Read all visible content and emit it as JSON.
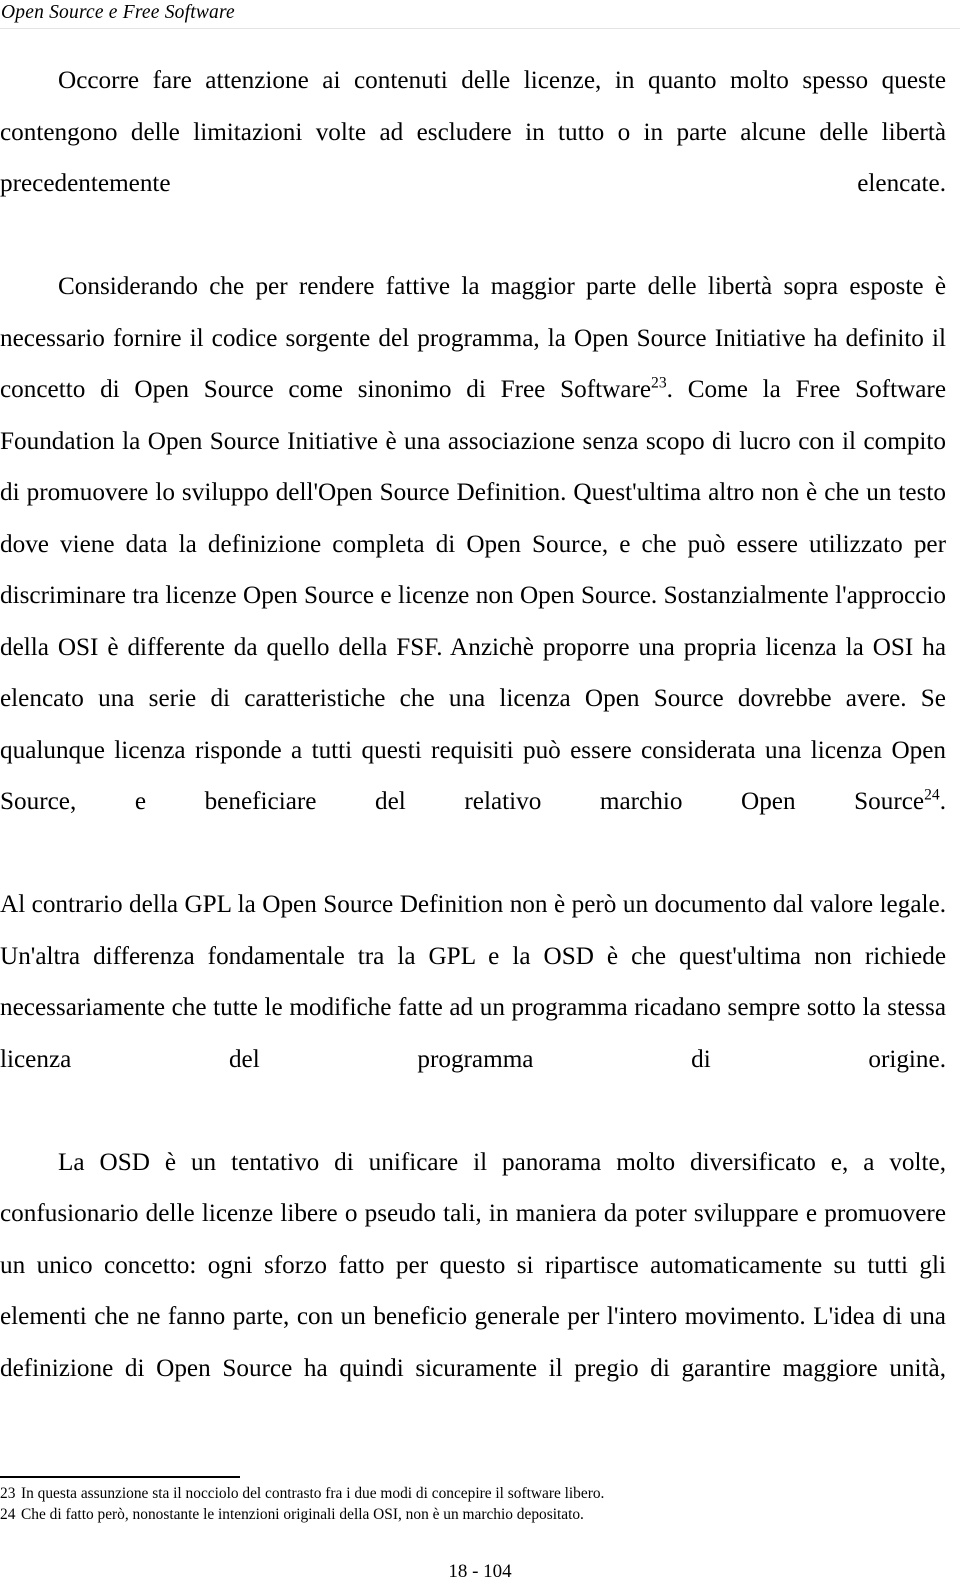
{
  "header": {
    "title": "Open Source e Free Software"
  },
  "body": {
    "paragraphs": [
      {
        "id": "paragraph-attenzione-licenze",
        "indent": true,
        "text": "Occorre fare attenzione ai contenuti delle licenze, in quanto molto spesso queste contengono delle limitazioni volte ad escludere in tutto o in parte alcune delle libertà precedentemente elencate."
      },
      {
        "id": "paragraph-open-source-initiative",
        "indent": true,
        "text_before_note_23": "Considerando che per rendere fattive la maggior parte delle libertà sopra esposte è necessario fornire il codice sorgente del programma, la Open Source Initiative ha definito il concetto di Open Source come sinonimo di Free Software",
        "note_23": "23",
        "text_between_notes": ". Come la Free Software Foundation la Open Source Initiative è una associazione senza scopo di lucro con il compito di promuovere lo sviluppo dell'Open Source Definition. Quest'ultima altro non è che un testo dove viene data la definizione completa di Open Source, e che può essere utilizzato per discriminare tra licenze Open Source e licenze non Open Source. Sostanzialmente l'approccio della OSI è differente da quello della FSF. Anzichè proporre una propria licenza la OSI ha elencato una serie di caratteristiche che una licenza Open Source dovrebbe avere. Se qualunque licenza risponde a tutti questi requisiti può essere considerata una licenza Open Source, e beneficiare del relativo marchio Open Source",
        "note_24": "24",
        "text_after_note_24": "."
      },
      {
        "id": "paragraph-al-contrario-gpl",
        "indent": false,
        "text": "Al contrario della GPL la Open Source Definition non è però un documento dal valore legale. Un'altra differenza fondamentale tra la GPL e la OSD è che quest'ultima non richiede necessariamente che tutte le modifiche fatte ad un programma ricadano sempre sotto la stessa licenza del programma di origine."
      },
      {
        "id": "paragraph-la-osd-tentativo",
        "indent": true,
        "text": "La OSD è un tentativo di unificare il panorama molto diversificato e, a volte, confusionario delle licenze libere o pseudo tali, in maniera da poter sviluppare e promuovere un unico concetto: ogni sforzo fatto per questo si ripartisce automaticamente su tutti gli elementi che ne fanno parte, con un beneficio generale per l'intero movimento. L'idea di una definizione di Open Source ha quindi sicuramente il pregio di garantire maggiore unità,"
      }
    ]
  },
  "footnotes": [
    {
      "number": "23",
      "text": "In questa assunzione sta il nocciolo del contrasto fra i due modi di concepire il software libero."
    },
    {
      "number": "24",
      "text": "Che di fatto però, nonostante le intenzioni originali della OSI, non è un marchio depositato."
    }
  ],
  "footer": {
    "page_label": "18 - 104"
  }
}
